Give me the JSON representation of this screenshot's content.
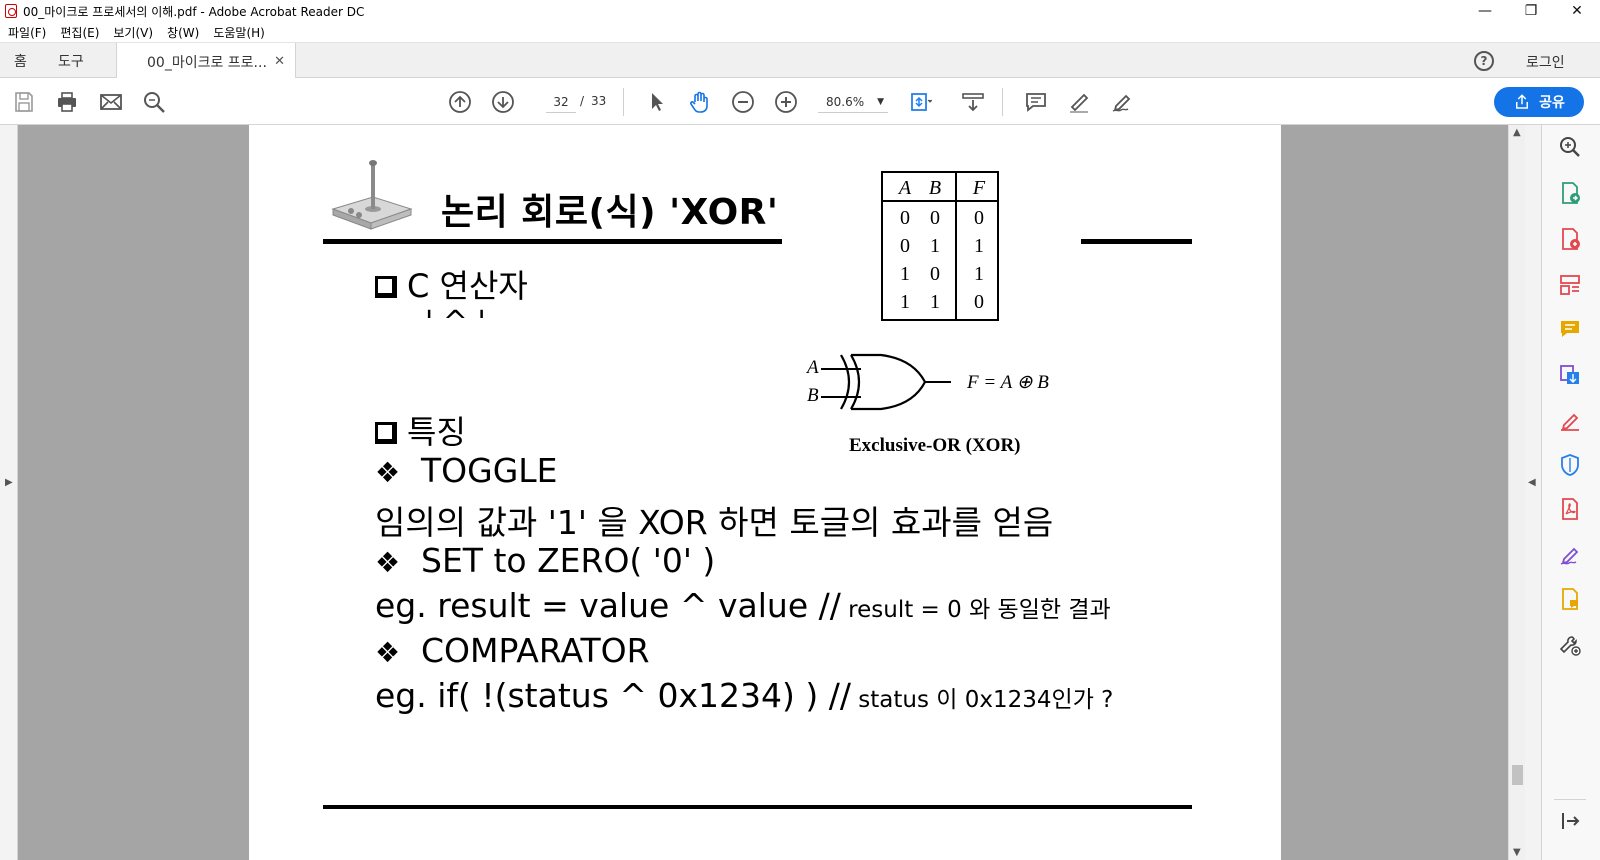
{
  "window": {
    "title": "00_마이크로 프로세서의 이해.pdf - Adobe Acrobat Reader DC"
  },
  "menu": [
    "파일(F)",
    "편집(E)",
    "보기(V)",
    "창(W)",
    "도움말(H)"
  ],
  "tabs": {
    "home": "홈",
    "tools": "도구",
    "doc": "00_마이크로 프로...",
    "login": "로그인"
  },
  "toolbar": {
    "page_current": "32",
    "page_separator": "/",
    "page_total": "33",
    "zoom": "80.6%",
    "share_label": "공유"
  },
  "slide": {
    "title": "논리 회로(식) 'XOR'",
    "heading1": "C 연산자",
    "operator": "' ^ '",
    "heading2": "특징",
    "lines": {
      "toggle": "TOGGLE",
      "toggle_desc": "임의의 값과 '1' 을 XOR 하면 토글의 효과를 얻음",
      "zero": "SET to ZERO( '0' )",
      "zero_eg": "eg. result = value ^ value  //",
      "zero_eg_note": " result = 0 와 동일한 결과",
      "comparator": "COMPARATOR",
      "comp_eg": "eg. if( !(status ^ 0x1234) ) //",
      "comp_eg_note": " status 이 0x1234인가 ?"
    },
    "truth_table": {
      "headers": [
        "A",
        "B",
        "F"
      ],
      "rows": [
        [
          "0",
          "0",
          "0"
        ],
        [
          "0",
          "1",
          "1"
        ],
        [
          "1",
          "0",
          "1"
        ],
        [
          "1",
          "1",
          "0"
        ]
      ]
    },
    "gate": {
      "input_a": "A",
      "input_b": "B",
      "output": "F = A ⊕ B",
      "caption": "Exclusive-OR (XOR)"
    }
  },
  "colors": {
    "accent": "#1473e6",
    "doc_bg": "#a5a5a5",
    "panel_icon_green": "#2d9d78",
    "panel_icon_red": "#e34850",
    "panel_icon_purple": "#7e4fd2",
    "panel_icon_yellow": "#e6a800",
    "panel_icon_blue": "#2680eb"
  }
}
